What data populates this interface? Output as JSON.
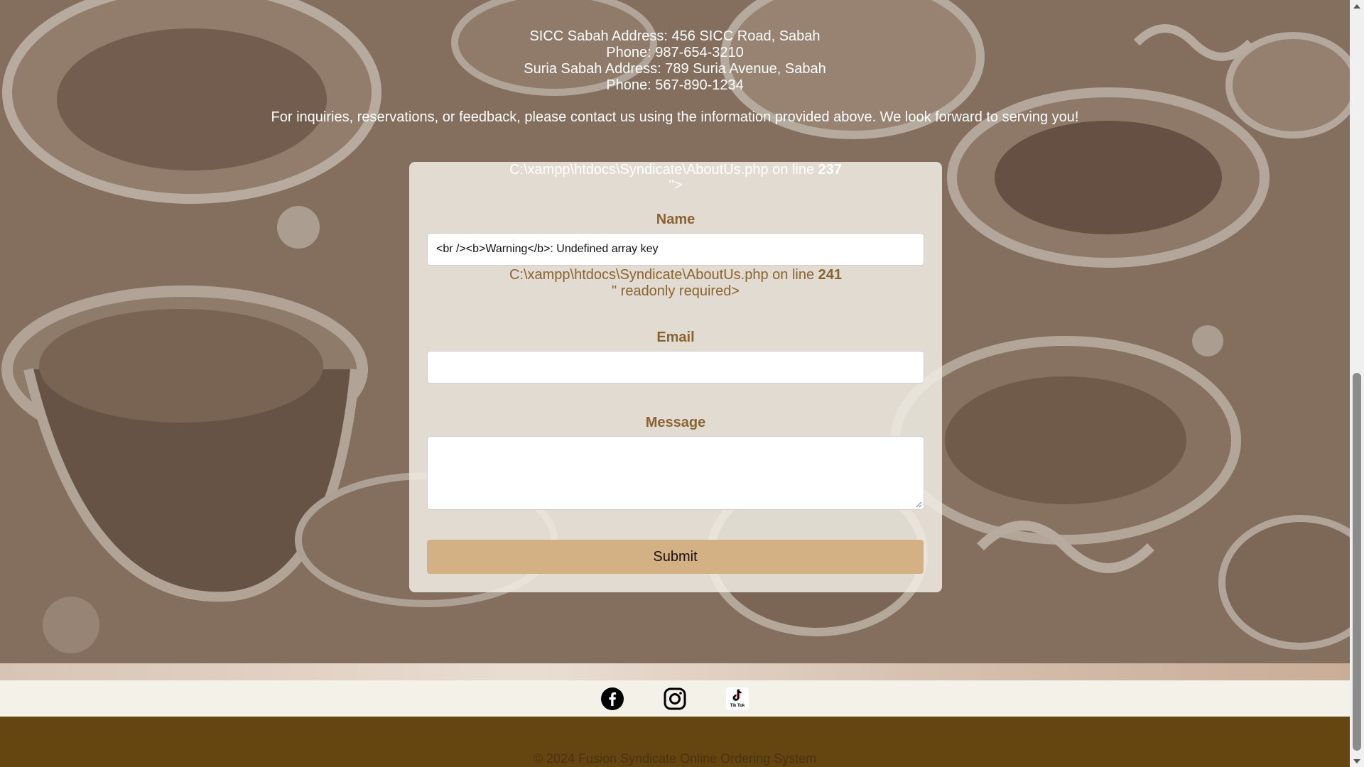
{
  "contact": {
    "sicc_address": "SICC Sabah Address: 456 SICC Road, Sabah",
    "sicc_phone": "Phone: 987-654-3210",
    "suria_address": "Suria Sabah Address: 789 Suria Avenue, Sabah",
    "suria_phone": "Phone: 567-890-1234",
    "inquiry_text": "For inquiries, reservations, or feedback, please contact us using the information provided above. We look forward to serving you!"
  },
  "form": {
    "error_top_path": "C:\\xampp\\htdocs\\Syndicate\\AboutUs.php on line ",
    "error_top_line": "237",
    "error_top_tail": "\">",
    "name_label": "Name",
    "name_value": "<br /><b>Warning</b>:  Undefined array key",
    "error_mid_path": "C:\\xampp\\htdocs\\Syndicate\\AboutUs.php on line ",
    "error_mid_line": "241",
    "error_mid_tail": "\" readonly required>",
    "email_label": "Email",
    "email_value": "",
    "message_label": "Message",
    "message_value": "",
    "submit_label": "Submit"
  },
  "social": {
    "icons": [
      "facebook-icon",
      "instagram-icon",
      "tiktok-icon"
    ],
    "tiktok_caption": "Tik Tok"
  },
  "footer": {
    "copyright": "© 2024 Fusion Syndicate Online Ordering System"
  },
  "colors": {
    "accent": "#8a6430",
    "submit_bg": "#d4b184",
    "footer_bg": "#664610",
    "social_bar_bg": "#f3f1e8"
  }
}
